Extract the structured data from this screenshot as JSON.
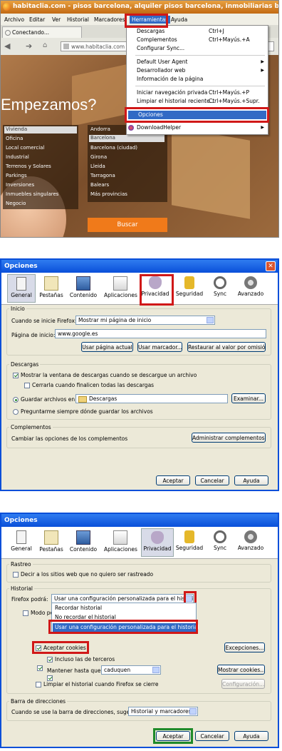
{
  "browser": {
    "title": "habitaclia.com - pisos barcelona, alquiler pisos barcelona, inmobiliarias barcelona - M",
    "menubar": [
      "Archivo",
      "Editar",
      "Ver",
      "Historial",
      "Marcadores",
      "Herramientas",
      "Ayuda"
    ],
    "tab_label": "Conectando...",
    "url": "www.habitaclia.com"
  },
  "site": {
    "headline": "Empezamos?",
    "types": [
      "Vivienda",
      "Oficina",
      "Local comercial",
      "Industrial",
      "Terrenos y Solares",
      "Parkings",
      "Inversiones",
      "Inmuebles singulares",
      "Negocio"
    ],
    "locations": [
      "Andorra",
      "Barcelona",
      "Barcelona (ciudad)",
      "Girona",
      "Lleida",
      "Tarragona",
      "Balears",
      "Más provincias"
    ],
    "search_button": "Buscar"
  },
  "tools_menu": {
    "items": [
      {
        "label": "Descargas",
        "shortcut": "Ctrl+J"
      },
      {
        "label": "Complementos",
        "shortcut": "Ctrl+Mayús.+A"
      },
      {
        "label": "Configurar Sync...",
        "shortcut": ""
      },
      {
        "label": "Default User Agent",
        "shortcut": ""
      },
      {
        "label": "Desarrollador web",
        "shortcut": ""
      },
      {
        "label": "Información de la página",
        "shortcut": ""
      },
      {
        "label": "Iniciar navegación privada",
        "shortcut": "Ctrl+Mayús.+P"
      },
      {
        "label": "Limpiar el historial reciente...",
        "shortcut": "Ctrl+Mayús.+Supr."
      },
      {
        "label": "Opciones",
        "shortcut": ""
      },
      {
        "label": "DownloadHelper",
        "shortcut": ""
      }
    ]
  },
  "options_general": {
    "title": "Opciones",
    "tabs": [
      "General",
      "Pestañas",
      "Contenido",
      "Aplicaciones",
      "Privacidad",
      "Seguridad",
      "Sync",
      "Avanzado"
    ],
    "inicio_group": "Inicio",
    "on_start_label": "Cuando se inicie Firefox:",
    "on_start_value": "Mostrar mi página de inicio",
    "homepage_label": "Página de inicio:",
    "homepage_value": "www.google.es",
    "btn_current": "Usar página actual",
    "btn_bookmark": "Usar marcador...",
    "btn_restore": "Restaurar al valor por omisión",
    "downloads_group": "Descargas",
    "show_downloads": "Mostrar la ventana de descargas cuando se descargue un archivo",
    "close_when_done": "Cerrarla cuando finalicen todas las descargas",
    "save_to_label": "Guardar archivos en",
    "save_to_folder": "Descargas",
    "btn_browse": "Examinar...",
    "ask_where": "Preguntarme siempre dónde guardar los archivos",
    "addons_group": "Complementos",
    "addons_text": "Cambiar las opciones de los complementos",
    "btn_addons": "Administrar complementos...",
    "ok": "Aceptar",
    "cancel": "Cancelar",
    "help": "Ayuda"
  },
  "options_privacy": {
    "title": "Opciones",
    "tracking_group": "Rastreo",
    "dnt": "Decir a los sitios web que no quiero ser rastreado",
    "history_group": "Historial",
    "firefox_will": "Firefox podrá:",
    "history_value": "Usar una configuración personalizada para el historial",
    "history_options": [
      "Recordar historial",
      "No recordar el historial",
      "Usar una configuración personalizada para el historial"
    ],
    "private_mode": "Modo pe",
    "accept_cookies": "Aceptar cookies",
    "btn_exceptions": "Excepciones...",
    "third_party": "Incluso las de terceros",
    "keep_until_label": "Mantener hasta que:",
    "keep_until_value": "caduquen",
    "btn_show_cookies": "Mostrar cookies...",
    "clear_on_close": "Limpiar el historial cuando Firefox se cierre",
    "btn_config": "Configuración...",
    "addressbar_group": "Barra de direcciones",
    "addressbar_label": "Cuando se use la barra de direcciones, sugerir:",
    "addressbar_value": "Historial y marcadores",
    "ok": "Aceptar",
    "cancel": "Cancelar",
    "help": "Ayuda"
  }
}
